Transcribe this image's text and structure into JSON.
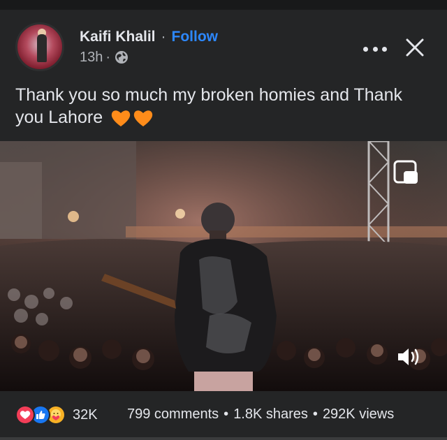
{
  "post": {
    "author": "Kaifi Khalil",
    "separator": "·",
    "follow_label": "Follow",
    "time": "13h",
    "time_separator": "·",
    "audience_icon": "globe-icon",
    "text": "Thank you so much my broken homies and Thank you Lahore",
    "emoji": [
      "orange-heart",
      "orange-heart"
    ]
  },
  "header_icons": [
    "more-options-icon",
    "close-icon"
  ],
  "media_icons": [
    "picture-in-picture-icon",
    "speaker-icon"
  ],
  "footer": {
    "reactions": [
      "love",
      "like",
      "care"
    ],
    "reaction_count": "32K",
    "comments": "799 comments",
    "shares": "1.8K shares",
    "views": "292K views",
    "separator": "•"
  },
  "colors": {
    "background": "#242526",
    "text": "#e4e6eb",
    "secondary_text": "#b0b3b8",
    "link": "#2d88ff",
    "orange_heart": "#ff8c1a",
    "love": "#f33e58",
    "like": "#1877f2",
    "care": "#f7b125"
  }
}
